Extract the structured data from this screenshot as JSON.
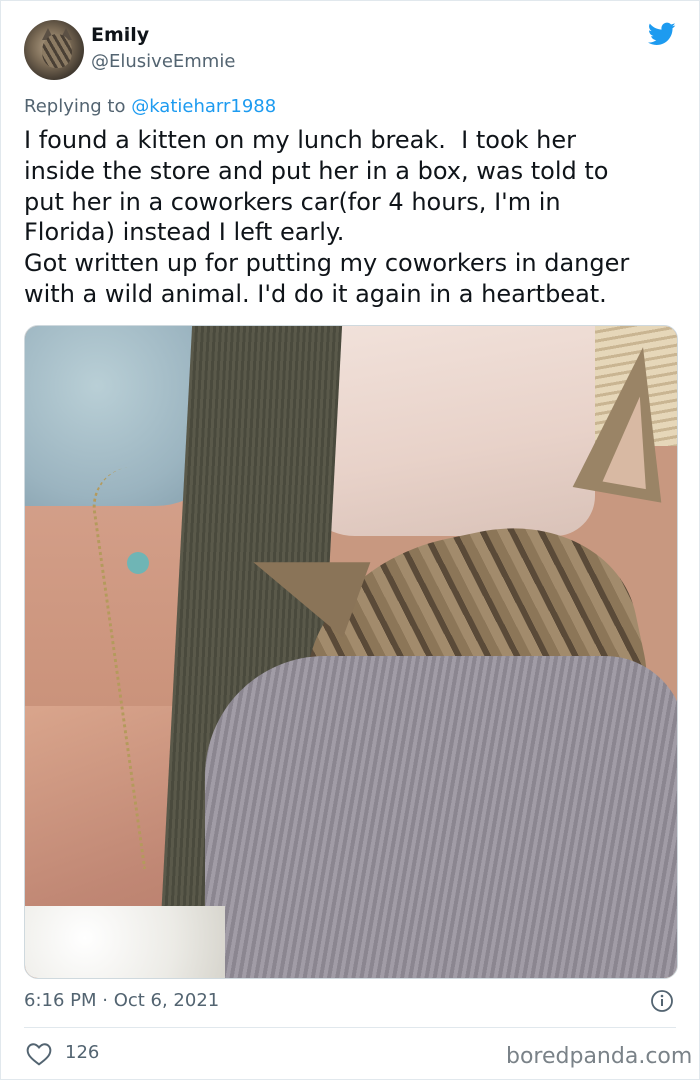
{
  "author": {
    "name": "Emily",
    "handle": "@ElusiveEmmie"
  },
  "reply": {
    "prefix": "Replying to ",
    "mention": "@katieharr1988"
  },
  "tweet": {
    "lines": [
      "I found a kitten on my lunch break.  I took her",
      "inside the store and put her in a box, was told to",
      "put her in a coworkers car(for 4 hours, I'm in",
      "Florida) instead I left early.",
      "Got written up for putting my coworkers in danger",
      "with a wild animal. I'd do it again in a heartbeat."
    ]
  },
  "media": {
    "icon": "photo-kitten-sleeping-on-sweater"
  },
  "meta": {
    "timestamp": "6:16 PM · Oct 6, 2021"
  },
  "engagement": {
    "likes": "126"
  },
  "watermark": "boredpanda.com",
  "colors": {
    "twitter_blue": "#1d9bf0",
    "secondary_text": "#536471",
    "primary_text": "#0f1419"
  },
  "icons": {
    "logo": "twitter-bird-icon",
    "info": "info-icon",
    "like": "heart-icon"
  }
}
